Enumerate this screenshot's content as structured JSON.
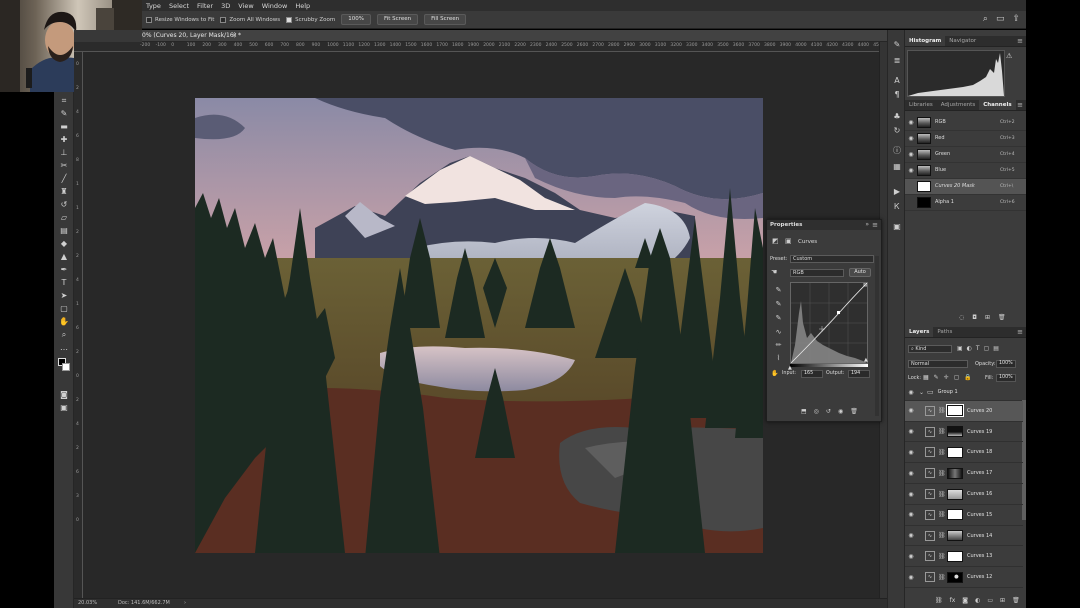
{
  "menu": [
    "Type",
    "Select",
    "Filter",
    "3D",
    "View",
    "Window",
    "Help"
  ],
  "options": {
    "resize_windows_label": "Resize Windows to Fit",
    "zoom_all_label": "Zoom All Windows",
    "scrubby_label": "Scrubby Zoom",
    "btn_100": "100%",
    "btn_fit": "Fit Screen",
    "btn_fill": "Fill Screen"
  },
  "document": {
    "tab_title": "0% (Curves 20, Layer Mask/16) *",
    "ruler_ticks": [
      "-200",
      "-100",
      "0",
      "100",
      "200",
      "300",
      "400",
      "500",
      "600",
      "700",
      "800",
      "900",
      "1000",
      "1100",
      "1200",
      "1300",
      "1400",
      "1500",
      "1600",
      "1700",
      "1800",
      "1900",
      "2000",
      "2100",
      "2200",
      "2300",
      "2400",
      "2500",
      "2600",
      "2700",
      "2800",
      "2900",
      "3000",
      "3100",
      "3200",
      "3300",
      "3400",
      "3500",
      "3600",
      "3700",
      "3800",
      "3900",
      "4000",
      "4100",
      "4200",
      "4300",
      "4400",
      "4500",
      "4600"
    ],
    "ruler_left_ticks": [
      "0",
      "2",
      "4",
      "6",
      "8",
      "1",
      "1",
      "2",
      "2",
      "4",
      "1",
      "6",
      "2",
      "0",
      "2",
      "4",
      "2",
      "6",
      "3",
      "0"
    ]
  },
  "status": {
    "zoom": "20.03%",
    "doc": "Doc: 141.6M/662.7M"
  },
  "histogram_panel": {
    "tabs": [
      "Histogram",
      "Navigator"
    ],
    "active": 0
  },
  "channels_panel": {
    "tabs": [
      "Libraries",
      "Adjustments",
      "Channels"
    ],
    "active": 2,
    "channels": [
      {
        "name": "RGB",
        "key": "Ctrl+2"
      },
      {
        "name": "Red",
        "key": "Ctrl+3"
      },
      {
        "name": "Green",
        "key": "Ctrl+4"
      },
      {
        "name": "Blue",
        "key": "Ctrl+5"
      },
      {
        "name": "Curves 20 Mask",
        "key": "Ctrl+\\"
      },
      {
        "name": "Alpha 1",
        "key": "Ctrl+6"
      }
    ]
  },
  "properties_panel": {
    "title": "Properties",
    "type_label": "Curves",
    "preset_label": "Preset:",
    "preset_value": "Custom",
    "channel_value": "RGB",
    "auto_label": "Auto",
    "input_label": "Input:",
    "input_value": "165",
    "output_label": "Output:",
    "output_value": "194"
  },
  "layers_panel": {
    "tabs": [
      "Layers",
      "Paths"
    ],
    "active": 0,
    "kind_label": "Kind",
    "blend_mode": "Normal",
    "opacity_label": "Opacity:",
    "opacity_value": "100%",
    "lock_label": "Lock:",
    "fill_label": "Fill:",
    "fill_value": "100%",
    "group_name": "Group 1",
    "layers": [
      {
        "name": "Curves 20",
        "mask": "white"
      },
      {
        "name": "Curves 19",
        "mask": "dark-top"
      },
      {
        "name": "Curves 18",
        "mask": "white"
      },
      {
        "name": "Curves 17",
        "mask": "dark-mix"
      },
      {
        "name": "Curves 16",
        "mask": "light-gray"
      },
      {
        "name": "Curves 15",
        "mask": "white"
      },
      {
        "name": "Curves 14",
        "mask": "gray-fade"
      },
      {
        "name": "Curves 13",
        "mask": "white"
      },
      {
        "name": "Curves 12",
        "mask": "black-dot"
      }
    ]
  },
  "colors": {
    "ui_dark": "#383838",
    "panel": "#3c3c3c",
    "canvas_bg": "#282828",
    "selected_row": "#575757"
  }
}
